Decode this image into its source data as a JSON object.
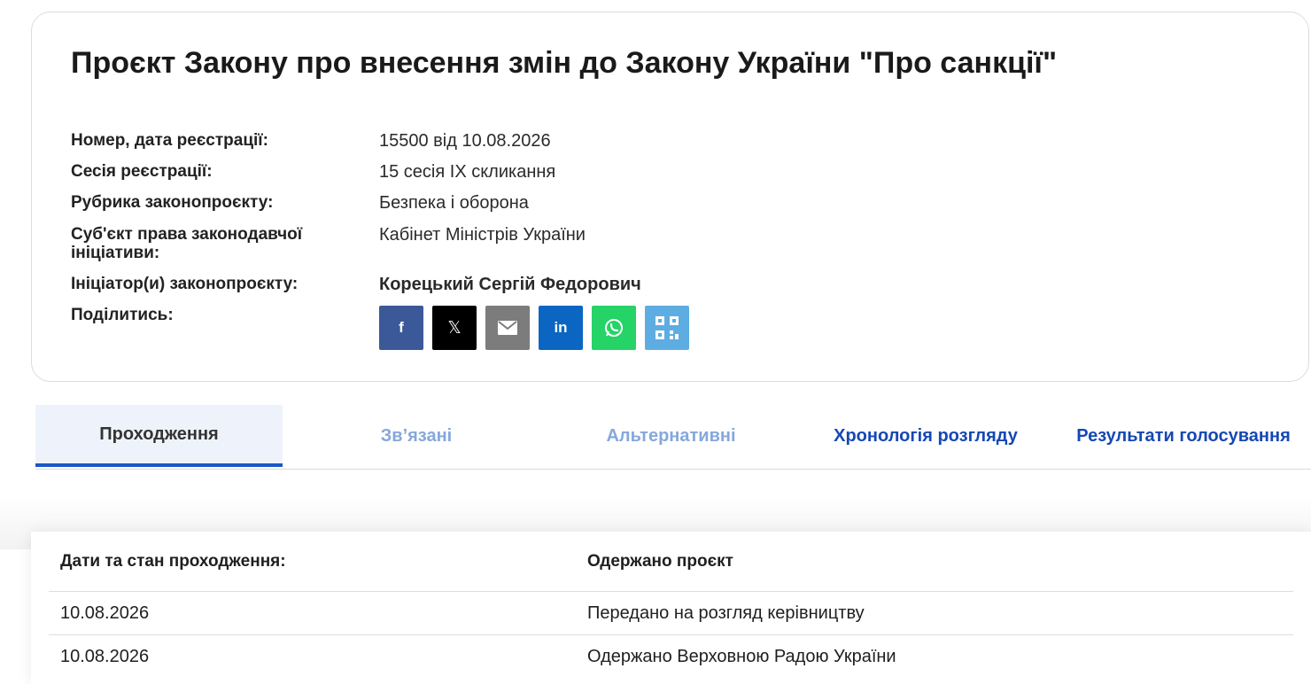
{
  "bill": {
    "title": "Проєкт Закону про внесення змін до Закону України \"Про санкції\"",
    "fields": [
      {
        "label": "Номер, дата реєстрації:",
        "value": "15500 від 10.08.2026"
      },
      {
        "label": "Сесія реєстрації:",
        "value": "15 сесія IX скликання"
      },
      {
        "label": "Рубрика законопроєкту:",
        "value": "Безпека і оборона"
      },
      {
        "label": "Суб'єкт права законодавчої ініціативи:",
        "value": "Кабінет Міністрів України"
      },
      {
        "label": "Ініціатор(и) законопроєкту:",
        "value": "Корецький Сергій Федорович"
      }
    ],
    "share_label": "Поділитись:"
  },
  "share_buttons": [
    {
      "icon": "facebook-icon",
      "glyph": "f",
      "color": "#3b5998"
    },
    {
      "icon": "x-icon",
      "glyph": "𝕏",
      "color": "#000000"
    },
    {
      "icon": "email-icon",
      "glyph": "",
      "color": "#7c7c7c"
    },
    {
      "icon": "linkedin-icon",
      "glyph": "in",
      "color": "#0a66c2"
    },
    {
      "icon": "whatsapp-icon",
      "glyph": "",
      "color": "#25d366"
    },
    {
      "icon": "qr-code-icon",
      "glyph": "",
      "color": "#5dade2"
    }
  ],
  "tabs": [
    {
      "label": "Проходження",
      "state": "active"
    },
    {
      "label": "Зв’язані",
      "state": "disabled"
    },
    {
      "label": "Альтернативні",
      "state": "disabled"
    },
    {
      "label": "Хронологія розгляду",
      "state": "link"
    },
    {
      "label": "Результати голосування",
      "state": "link"
    }
  ],
  "progress": {
    "header": {
      "col1": "Дати та стан проходження:",
      "col2": "Одержано проєкт"
    },
    "rows": [
      {
        "date": "10.08.2026",
        "status": "Передано на розгляд керівництву"
      },
      {
        "date": "10.08.2026",
        "status": "Одержано Верховною Радою України"
      }
    ]
  }
}
